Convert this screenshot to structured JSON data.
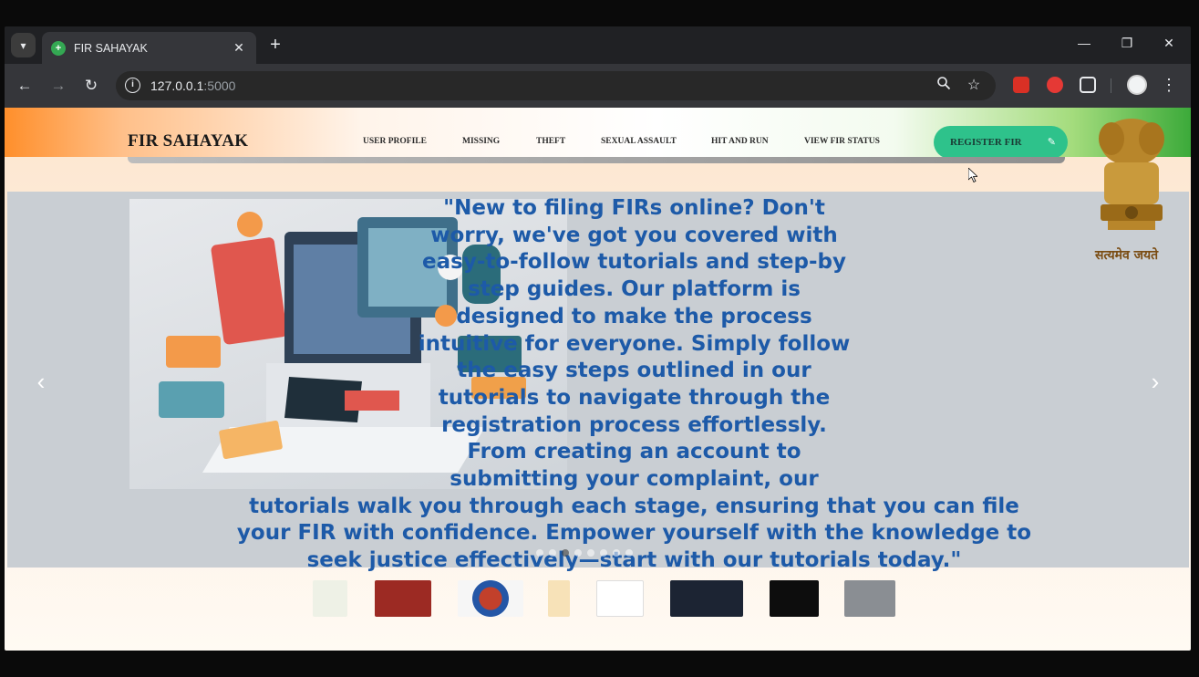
{
  "browser": {
    "tab_title": "FIR SAHAYAK",
    "tab_close": "✕",
    "new_tab": "+",
    "url_host": "127.0.0.1",
    "url_port": ":5000",
    "window_controls": {
      "minimize": "—",
      "maximize": "❐",
      "close": "✕"
    },
    "nav": {
      "back": "←",
      "forward": "→",
      "reload": "↻"
    },
    "icons": [
      "zoom-icon",
      "bookmark-star-icon",
      "extension-red-icon",
      "extension-shield-icon",
      "extensions-puzzle-icon",
      "profile-avatar",
      "menu-icon"
    ],
    "colors": {
      "frame": "#202124",
      "toolbar": "#35363a",
      "omnibox": "#282828",
      "text": "#e8eaed"
    }
  },
  "site": {
    "brand": "FIR SAHAYAK",
    "nav": [
      "USER PROFILE",
      "MISSING",
      "THEFT",
      "SEXUAL ASSAULT",
      "HIT AND RUN",
      "VIEW FIR STATUS"
    ],
    "register_button": "REGISTER FIR",
    "register_icon": "✎",
    "emblem_motto": "सत्यमेव जयते",
    "colors": {
      "saffron": "#ff8f2b",
      "green": "#3caa3a",
      "register": "#2ec28b",
      "slide_text": "#1d5aa8"
    }
  },
  "carousel": {
    "prev": "‹",
    "next": "›",
    "slide_text": "\"New to filing FIRs online? Don't\nworry, we've got you covered with\neasy-to-follow tutorials and step-by\nstep guides. Our platform is\ndesigned to make the process\nintuitive for everyone. Simply follow\nthe easy steps outlined in our\ntutorials to navigate through the\nregistration process effortlessly.\nFrom creating an account to\nsubmitting your complaint, our\ntutorials walk you through each stage, ensuring that you can file\nyour FIR with confidence. Empower yourself with the knowledge to\nseek justice effectively—start with our tutorials today.\"",
    "indicator_count": 8,
    "active_indicator": 2
  },
  "logos": [
    "state-police-logo-1",
    "jammu-kashmir-police-logo",
    "delhi-police-logo",
    "police-badge-logo",
    "uttarakhand-police-logo",
    "dark-police-logo",
    "tamil-nadu-police-logo",
    "grey-police-logo"
  ]
}
